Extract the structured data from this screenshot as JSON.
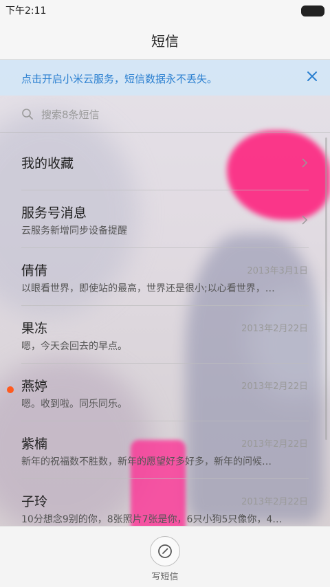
{
  "status_bar": {
    "time": "下午2:11"
  },
  "header": {
    "title": "短信"
  },
  "notice": {
    "text": "点击开启小米云服务，短信数据永不丢失。",
    "close_icon": "close-icon",
    "color": "#2a7fd0"
  },
  "search": {
    "placeholder": "搜索8条短信",
    "icon": "search-icon"
  },
  "list": {
    "items": [
      {
        "name": "我的收藏",
        "preview": "",
        "date": "",
        "has_chevron": true
      },
      {
        "name": "服务号消息",
        "preview": "云服务新增同步设备提醒",
        "date": "",
        "has_chevron": true
      },
      {
        "name": "倩倩",
        "preview": "以眼看世界，即使站的最高，世界还是很小;以心看世界，…",
        "date": "2013年3月1日"
      },
      {
        "name": "果冻",
        "preview": "嗯，今天会回去的早点。",
        "date": "2013年2月22日"
      },
      {
        "name": "燕婷",
        "preview": "嗯。收到啦。同乐同乐。",
        "date": "2013年2月22日",
        "unread": true
      },
      {
        "name": "紫楠",
        "preview": "新年的祝福数不胜数，新年的愿望好多好多，新年的问候…",
        "date": "2013年2月22日"
      },
      {
        "name": "子玲",
        "preview": "10分想念9别的你，8张照片7张是你，6只小狗5只像你，4…",
        "date": "2013年2月22日"
      }
    ]
  },
  "bottom": {
    "compose_label": "写短信",
    "compose_icon": "compose-icon"
  },
  "colors": {
    "unread_dot": "#ff5a1f",
    "accent": "#2a7fd0"
  }
}
